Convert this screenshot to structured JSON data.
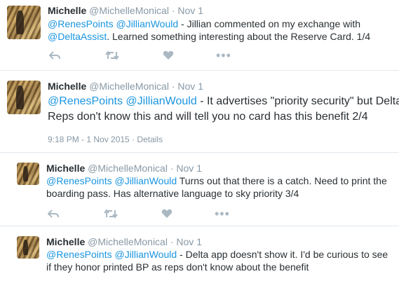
{
  "tweets": [
    {
      "name": "Michelle",
      "handle": "@MichelleMonical",
      "dot": "·",
      "time": "Nov 1",
      "line1_m1": "@RenesPoints",
      "line1_m2": "@JillianWould",
      "line1_rest": " - Jillian commented on my exchange with",
      "line2_m1": "@DeltaAssist",
      "line2_rest": ". Learned something interesting about the Reserve Card. 1/4",
      "more": "•••"
    },
    {
      "name": "Michelle",
      "handle": "@MichelleMonical",
      "dot": "·",
      "time": "Nov 1",
      "line1_m1": "@RenesPoints",
      "line1_m2": "@JillianWould",
      "line1_rest": " - It advertises \"priority security\" but Delta",
      "line2": "Reps don't know this and will tell you no card has this benefit 2/4",
      "meta_time": "9:18 PM - 1 Nov 2015",
      "meta_sep": " · ",
      "meta_details": "Details"
    },
    {
      "name": "Michelle",
      "handle": "@MichelleMonical",
      "dot": "·",
      "time": "Nov 1",
      "line1_m1": "@RenesPoints",
      "line1_m2": "@JillianWould",
      "line1_rest": " Turns out that there is a catch. Need to print the",
      "line2": "boarding pass. Has alternative language to sky priority 3/4",
      "more": "•••"
    },
    {
      "name": "Michelle",
      "handle": "@MichelleMonical",
      "dot": "·",
      "time": "Nov 1",
      "line1_m1": "@RenesPoints",
      "line1_m2": "@JillianWould",
      "line1_rest": " - Delta app doesn't show it. I'd be curious to see",
      "line2": "if they honor printed BP as reps don't know about the benefit"
    }
  ],
  "colors": {
    "mention": "#1b95e0",
    "muted": "#8899a6",
    "text": "#292f33",
    "icon": "#aab8c2"
  },
  "icons": [
    "reply-icon",
    "retweet-icon",
    "like-icon",
    "more-icon"
  ]
}
